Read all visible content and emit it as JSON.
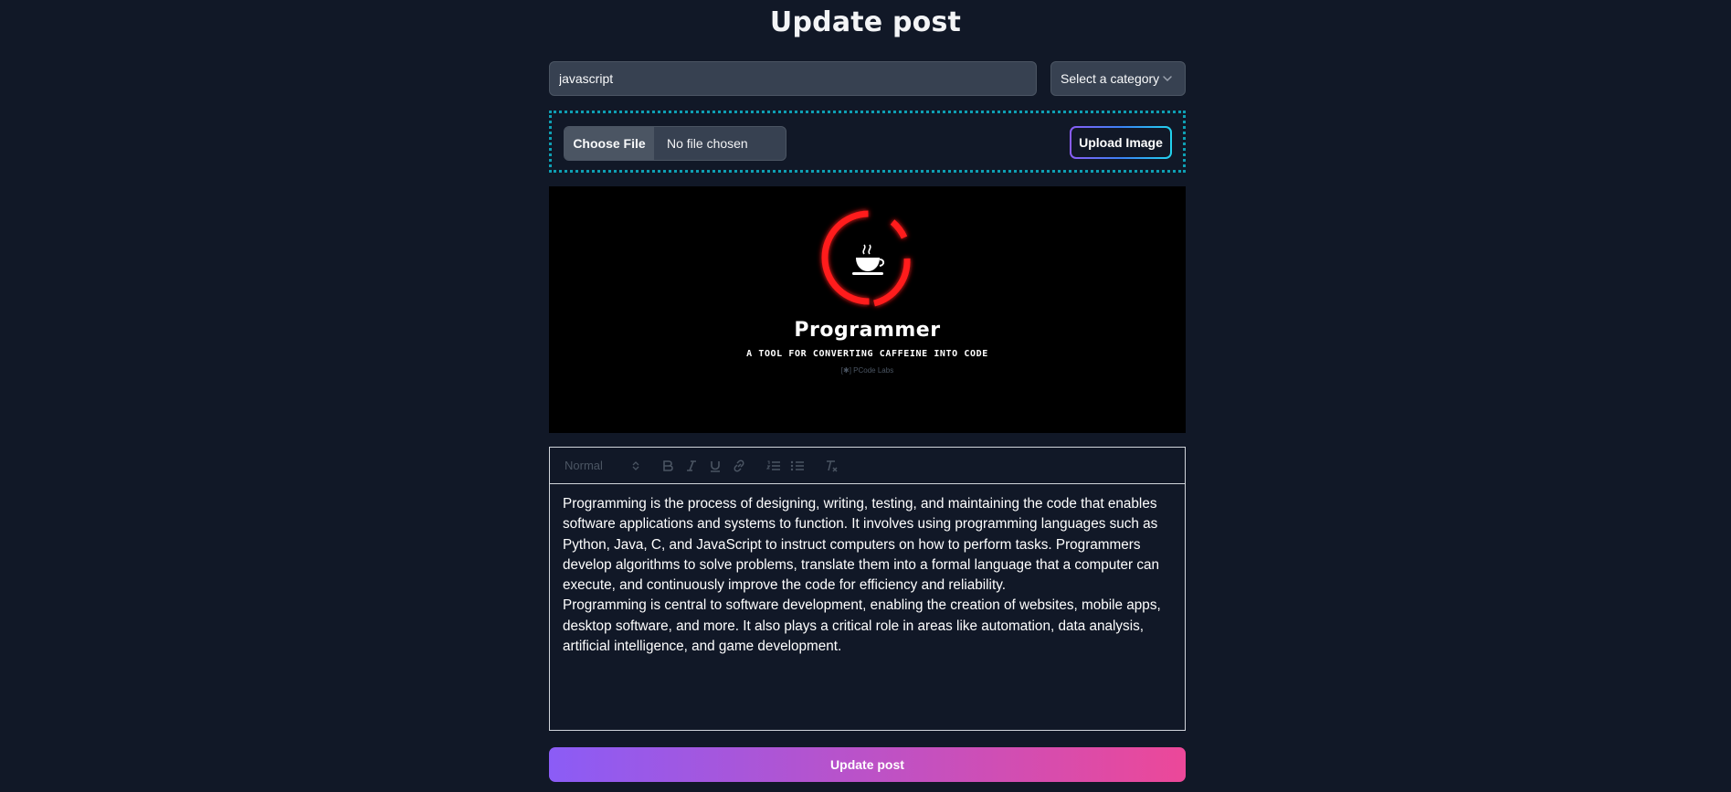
{
  "page": {
    "title": "Update post"
  },
  "form": {
    "title_value": "javascript",
    "category": {
      "selected": "Select a category"
    },
    "file": {
      "button_label": "Choose File",
      "status": "No file chosen"
    },
    "upload_button": "Upload Image",
    "preview": {
      "heading": "Programmer",
      "subtitle": "A TOOL FOR CONVERTING CAFFEINE INTO CODE",
      "credit": "[✱] PCode Labs",
      "icon": "coffee-cup-icon",
      "ring_color": "#ff1a1a"
    },
    "editor": {
      "toolbar": {
        "format": "Normal",
        "buttons": [
          "bold-icon",
          "italic-icon",
          "underline-icon",
          "link-icon",
          "ordered-list-icon",
          "bullet-list-icon",
          "clear-format-icon"
        ]
      },
      "paragraphs": [
        "Programming is the process of designing, writing, testing, and maintaining the code that enables software applications and systems to function. It involves using programming languages such as Python, Java, C, and JavaScript to instruct computers on how to perform tasks. Programmers develop algorithms to solve problems, translate them into a formal language that a computer can execute, and continuously improve the code for efficiency and reliability.",
        "Programming is central to software development, enabling the creation of websites, mobile apps, desktop software, and more. It also plays a critical role in areas like automation, data analysis, artificial intelligence, and game development."
      ]
    },
    "submit_label": "Update post"
  },
  "colors": {
    "background": "#111827",
    "input": "#374151",
    "dropzone_border": "#0e9fb3",
    "gradient_start": "#8b5cf6",
    "gradient_end": "#ec4899"
  }
}
